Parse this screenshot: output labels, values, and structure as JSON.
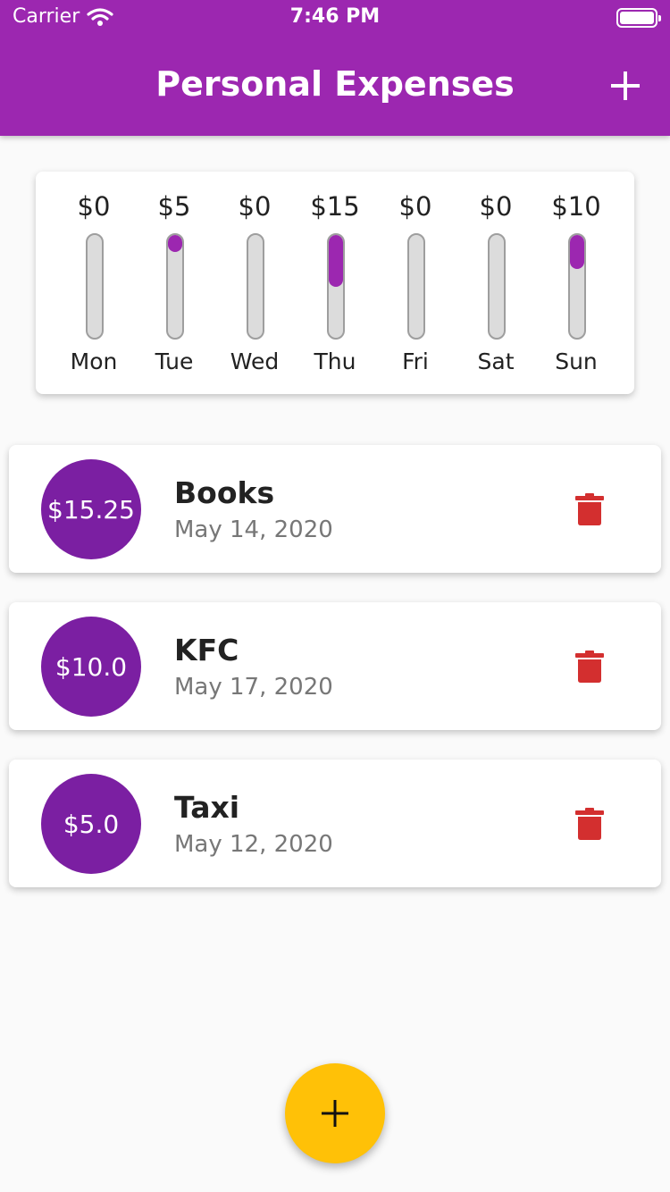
{
  "status_bar": {
    "carrier": "Carrier",
    "time": "7:46 PM",
    "icons": [
      "wifi-icon",
      "battery-icon"
    ]
  },
  "app_bar": {
    "title": "Personal Expenses",
    "add_icon": "plus-icon"
  },
  "colors": {
    "primary": "#9c27b0",
    "avatar": "#7b1fa2",
    "fab": "#ffc107",
    "delete": "#d32f2f",
    "bar_track": "#dcdcdc"
  },
  "weekly_chart": {
    "bars": [
      {
        "day": "Mon",
        "amount": "$0",
        "fraction": 0.0
      },
      {
        "day": "Tue",
        "amount": "$5",
        "fraction": 0.167
      },
      {
        "day": "Wed",
        "amount": "$0",
        "fraction": 0.0
      },
      {
        "day": "Thu",
        "amount": "$15",
        "fraction": 0.5
      },
      {
        "day": "Fri",
        "amount": "$0",
        "fraction": 0.0
      },
      {
        "day": "Sat",
        "amount": "$0",
        "fraction": 0.0
      },
      {
        "day": "Sun",
        "amount": "$10",
        "fraction": 0.333
      }
    ]
  },
  "transactions": [
    {
      "amount": "$15.25",
      "title": "Books",
      "date": "May 14, 2020",
      "delete_icon": "trash-icon"
    },
    {
      "amount": "$10.0",
      "title": "KFC",
      "date": "May 17, 2020",
      "delete_icon": "trash-icon"
    },
    {
      "amount": "$5.0",
      "title": "Taxi",
      "date": "May 12, 2020",
      "delete_icon": "trash-icon"
    }
  ],
  "fab": {
    "icon": "plus-icon"
  }
}
